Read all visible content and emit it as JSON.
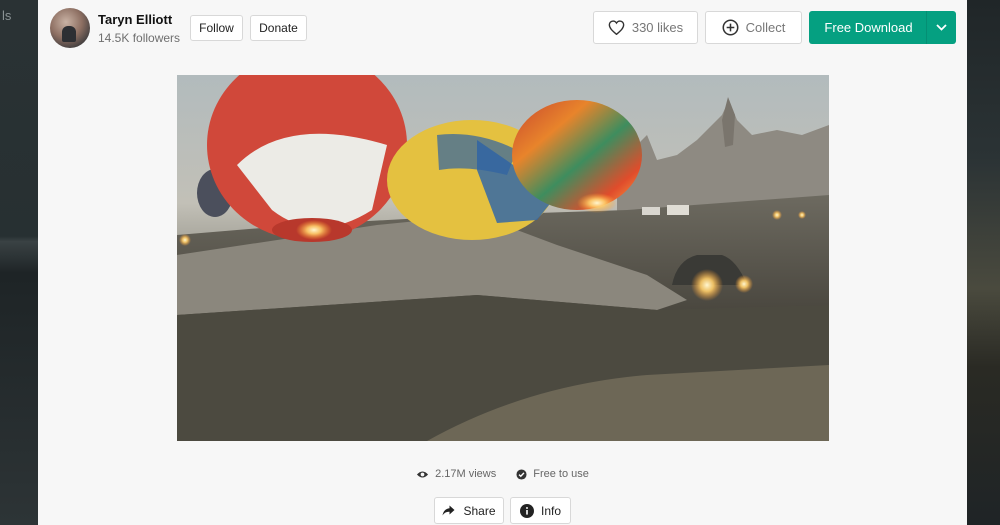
{
  "background": {
    "left_text": "ls"
  },
  "author": {
    "name": "Taryn Elliott",
    "followers": "14.5K followers"
  },
  "actions": {
    "follow_label": "Follow",
    "donate_label": "Donate",
    "likes_label": "330 likes",
    "collect_label": "Collect",
    "download_label": "Free Download"
  },
  "meta": {
    "views": "2.17M views",
    "license": "Free to use"
  },
  "footer": {
    "share_label": "Share",
    "info_label": "Info"
  },
  "colors": {
    "accent": "#05a081",
    "modal_bg": "#f7f7f7",
    "backdrop": "#1f2426"
  },
  "icons": {
    "heart": "heart-icon",
    "collect": "plus-circle-icon",
    "dropdown": "chevron-down-icon",
    "views": "eye-icon",
    "license": "check-circle-icon",
    "share": "share-arrow-icon",
    "info": "info-icon"
  }
}
